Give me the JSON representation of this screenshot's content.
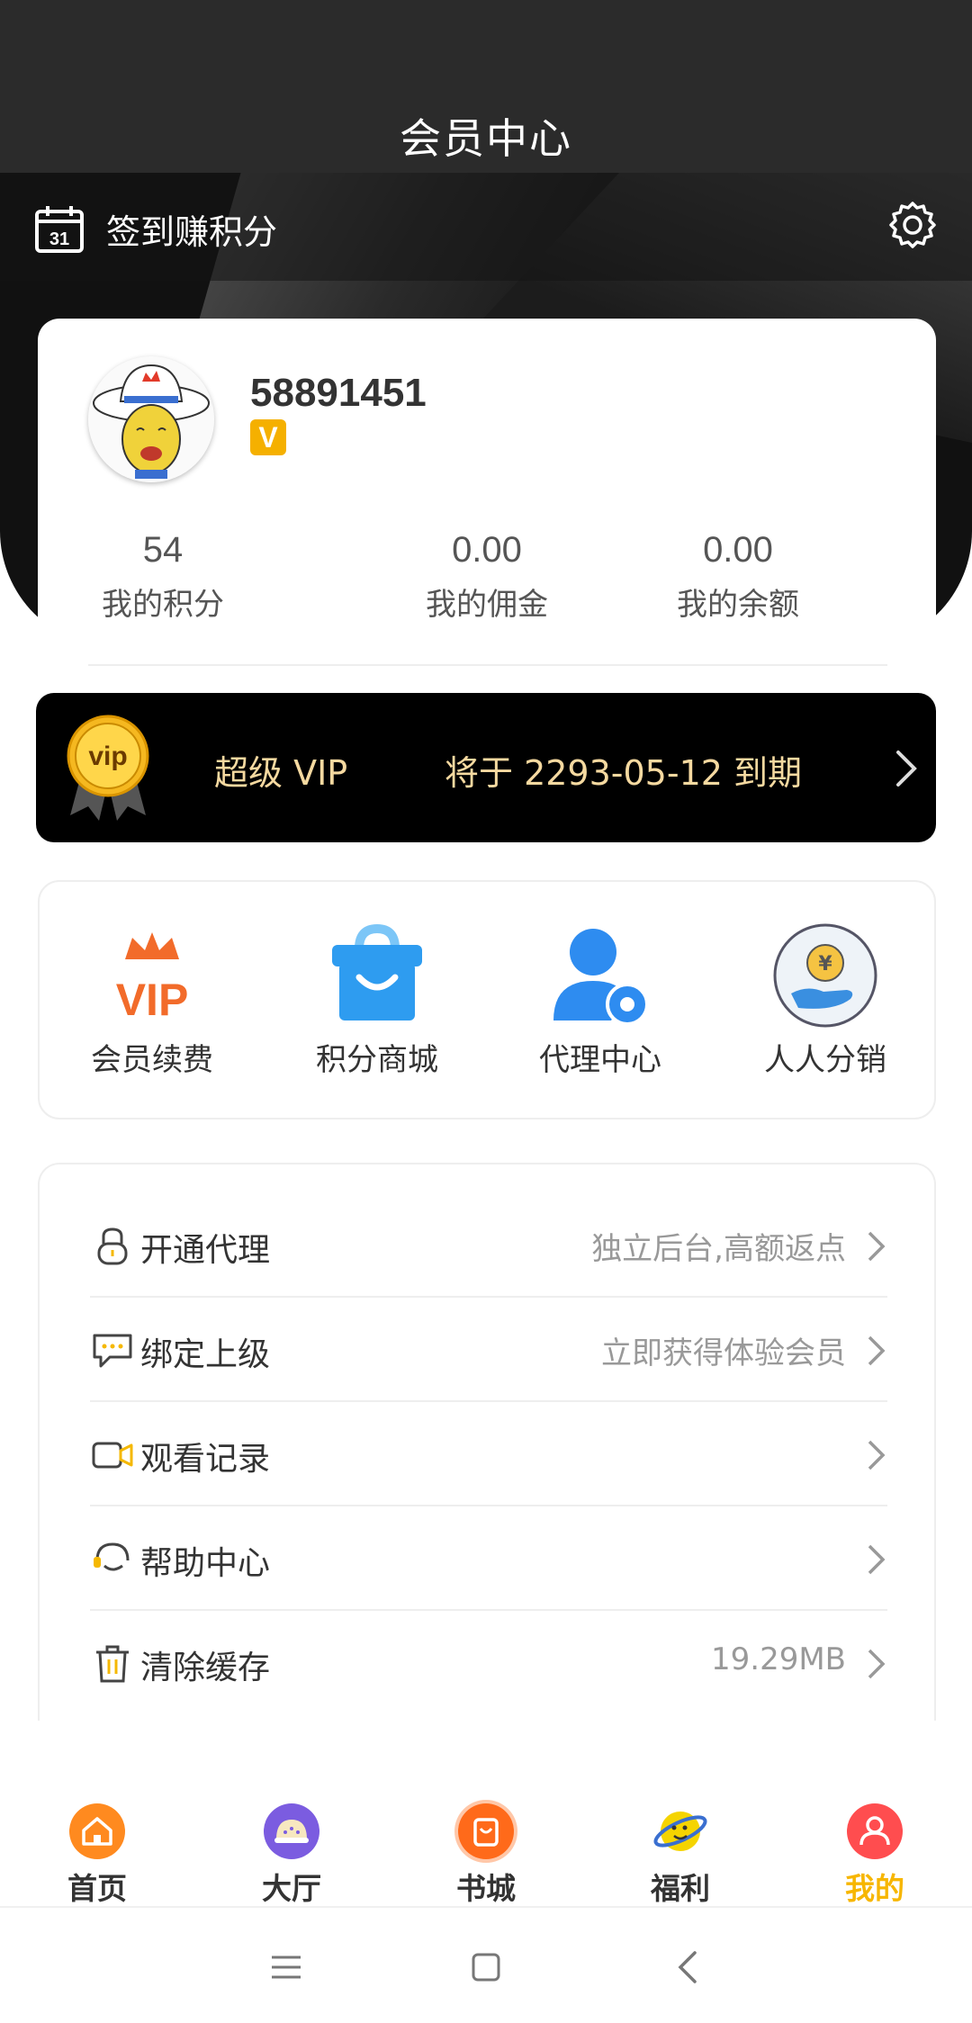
{
  "header": {
    "title": "会员中心",
    "checkin_label": "签到赚积分",
    "calendar_day": "31"
  },
  "profile": {
    "user_id": "58891451",
    "badge": "V",
    "stats": [
      {
        "value": "54",
        "label": "我的积分"
      },
      {
        "value": "0.00",
        "label": "我的佣金"
      },
      {
        "value": "0.00",
        "label": "我的余额"
      }
    ]
  },
  "vip": {
    "medal_text": "vip",
    "level": "超级 VIP",
    "expire": "将于 2293-05-12 到期"
  },
  "quick_menu": [
    {
      "label": "会员续费",
      "icon": "vip-crown-icon"
    },
    {
      "label": "积分商城",
      "icon": "shopping-bag-icon"
    },
    {
      "label": "代理中心",
      "icon": "agent-gear-icon"
    },
    {
      "label": "人人分销",
      "icon": "coin-hand-icon"
    }
  ],
  "list": [
    {
      "label": "开通代理",
      "value": "独立后台,高额返点",
      "icon": "lock-icon"
    },
    {
      "label": "绑定上级",
      "value": "立即获得体验会员",
      "icon": "chat-icon"
    },
    {
      "label": "观看记录",
      "value": "",
      "icon": "video-icon"
    },
    {
      "label": "帮助中心",
      "value": "",
      "icon": "headset-icon"
    },
    {
      "label": "清除缓存",
      "value": "19.29MB",
      "icon": "trash-icon"
    }
  ],
  "nav": [
    {
      "label": "首页",
      "icon": "home-icon",
      "color": "#ff8a1f"
    },
    {
      "label": "大厅",
      "icon": "hall-icon",
      "color": "#7b5ce0"
    },
    {
      "label": "书城",
      "icon": "bookstore-icon",
      "color": "#ff6a1a"
    },
    {
      "label": "福利",
      "icon": "planet-icon",
      "color": "#f5d400"
    },
    {
      "label": "我的",
      "icon": "profile-icon",
      "color": "#ff4d4f",
      "active": true
    }
  ],
  "colors": {
    "accent": "#f7b600",
    "vip_text": "#f5d9a0",
    "header_bg": "#2b2b2b"
  }
}
